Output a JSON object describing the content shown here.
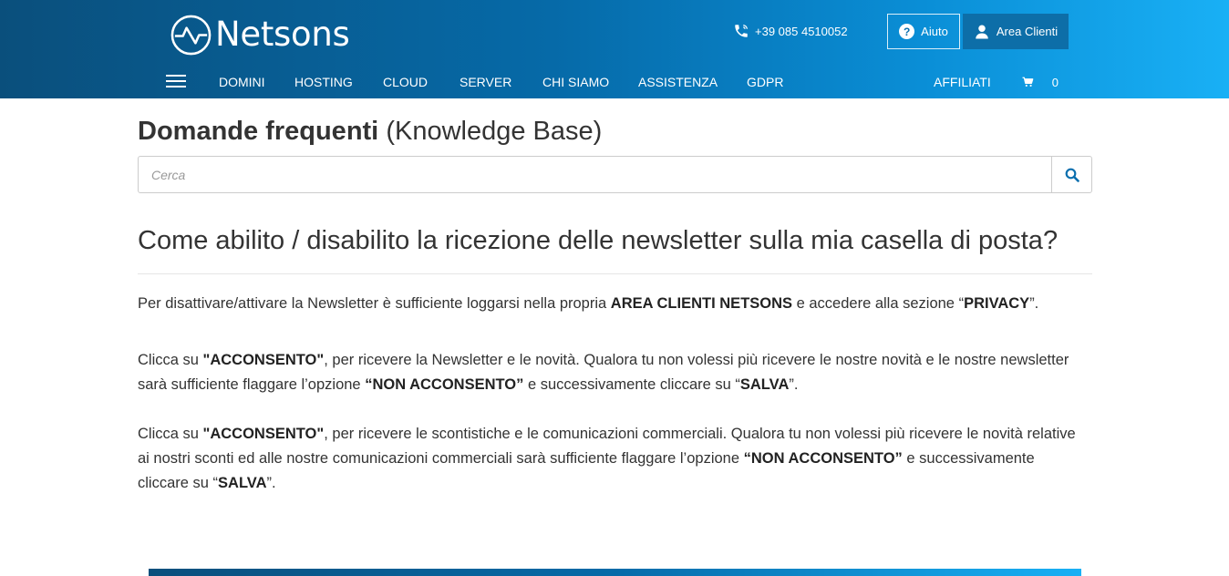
{
  "header": {
    "logo_text": "Netsons",
    "phone": "+39 085 4510052",
    "help_label": "Aiuto",
    "area_label": "Area Clienti"
  },
  "nav": {
    "items": [
      "DOMINI",
      "HOSTING",
      "CLOUD",
      "SERVER",
      "CHI SIAMO",
      "ASSISTENZA",
      "GDPR"
    ],
    "affiliati": "AFFILIATI",
    "cart_count": "0"
  },
  "kb": {
    "title_bold": "Domande frequenti",
    "title_light": "(Knowledge Base)",
    "search_placeholder": "Cerca"
  },
  "article": {
    "title": "Come abilito / disabilito la ricezione delle newsletter sulla mia casella di posta?",
    "p1": {
      "a": "Per disattivare/attivare la Newsletter è sufficiente loggarsi nella propria ",
      "b": "AREA CLIENTI NETSONS",
      "c": " e accedere alla sezione “",
      "d": "PRIVACY",
      "e": "”."
    },
    "p2": {
      "a": "Clicca su ",
      "b": "\"ACCONSENTO\"",
      "c": ", per ricevere la Newsletter e le novità. Qualora tu non volessi più ricevere le nostre novità e le nostre newsletter sarà sufficiente flaggare l’opzione  ",
      "d": "“NON ACCONSENTO”",
      "e": " e successivamente cliccare su “",
      "f": "SALVA",
      "g": "”."
    },
    "p3": {
      "a": "Clicca su ",
      "b": "\"ACCONSENTO\"",
      "c": ", per ricevere le scontistiche e le comunicazioni commerciali. Qualora tu non volessi più ricevere le novità relative ai nostri sconti ed alle nostre comunicazioni commerciali sarà sufficiente flaggare l’opzione  ",
      "d": "“NON ACCONSENTO”",
      "e": " e successivamente cliccare su “",
      "f": "SALVA",
      "g": "”."
    }
  },
  "icons": {
    "logo": "netsons-logo-icon",
    "phone": "phone-icon",
    "help": "question-circle-icon",
    "user": "user-icon",
    "menu": "hamburger-icon",
    "cart": "cart-icon",
    "search": "search-icon"
  },
  "colors": {
    "header_dark": "#0a4f7c",
    "header_light": "#19b0f5",
    "area_button": "#0d6ea8",
    "search_icon": "#0b6fae"
  }
}
